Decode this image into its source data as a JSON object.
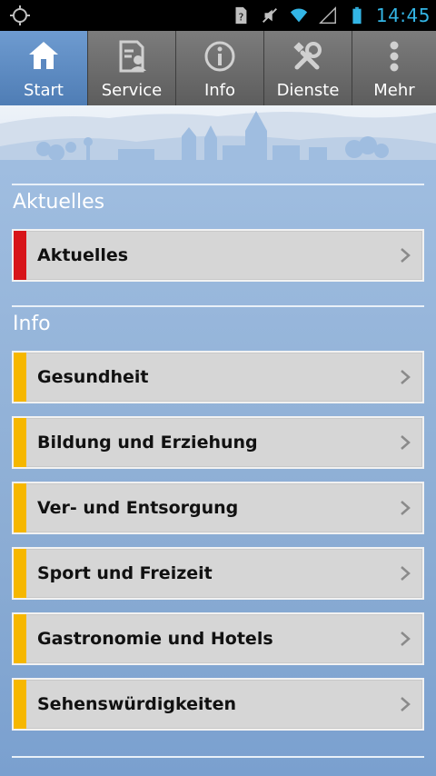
{
  "statusbar": {
    "time": "14:45"
  },
  "tabs": [
    {
      "label": "Start",
      "icon": "home-icon"
    },
    {
      "label": "Service",
      "icon": "document-person-icon"
    },
    {
      "label": "Info",
      "icon": "info-icon"
    },
    {
      "label": "Dienste",
      "icon": "tools-icon"
    },
    {
      "label": "Mehr",
      "icon": "more-vertical-icon"
    }
  ],
  "sections": [
    {
      "title": "Aktuelles",
      "items": [
        {
          "label": "Aktuelles",
          "color": "#d7141a"
        }
      ]
    },
    {
      "title": "Info",
      "items": [
        {
          "label": "Gesundheit",
          "color": "#f6b700"
        },
        {
          "label": "Bildung und Erziehung",
          "color": "#f6b700"
        },
        {
          "label": "Ver- und Entsorgung",
          "color": "#f6b700"
        },
        {
          "label": "Sport und Freizeit",
          "color": "#f6b700"
        },
        {
          "label": "Gastronomie und Hotels",
          "color": "#f6b700"
        },
        {
          "label": "Sehenswürdigkeiten",
          "color": "#f6b700"
        }
      ]
    }
  ],
  "colors": {
    "active_tab": "#5b88c0",
    "accent_news": "#d7141a",
    "accent_info": "#f6b700"
  }
}
